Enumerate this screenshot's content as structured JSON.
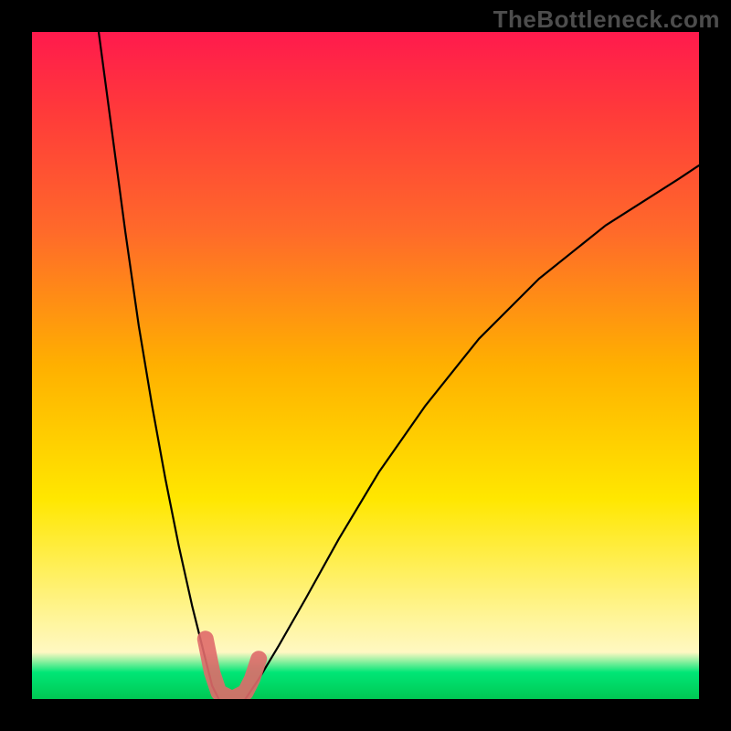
{
  "watermark": "TheBottleneck.com",
  "chart_data": {
    "type": "line",
    "title": "",
    "xlabel": "",
    "ylabel": "",
    "xlim": [
      0,
      100
    ],
    "ylim": [
      0,
      100
    ],
    "grid": false,
    "legend": false,
    "description": "Two black curves descending from the top toward a single minimum near x≈30, set against a vertical red→green gradient. A small pink/red highlight marks the valley floor.",
    "series": [
      {
        "name": "left-branch",
        "x": [
          10,
          12,
          14,
          16,
          18,
          20,
          22,
          24,
          26,
          27,
          28
        ],
        "y": [
          100,
          85,
          70,
          56,
          44,
          33,
          23,
          14,
          6,
          2,
          0
        ]
      },
      {
        "name": "right-branch",
        "x": [
          32,
          34,
          37,
          41,
          46,
          52,
          59,
          67,
          76,
          86,
          97,
          100
        ],
        "y": [
          0,
          3,
          8,
          15,
          24,
          34,
          44,
          54,
          63,
          71,
          78,
          80
        ]
      }
    ],
    "floor_highlight": {
      "x": [
        26,
        27,
        28,
        30,
        32,
        33,
        34
      ],
      "y": [
        9,
        4,
        1,
        0,
        1,
        3,
        6
      ],
      "color": "#e06a6a"
    }
  }
}
